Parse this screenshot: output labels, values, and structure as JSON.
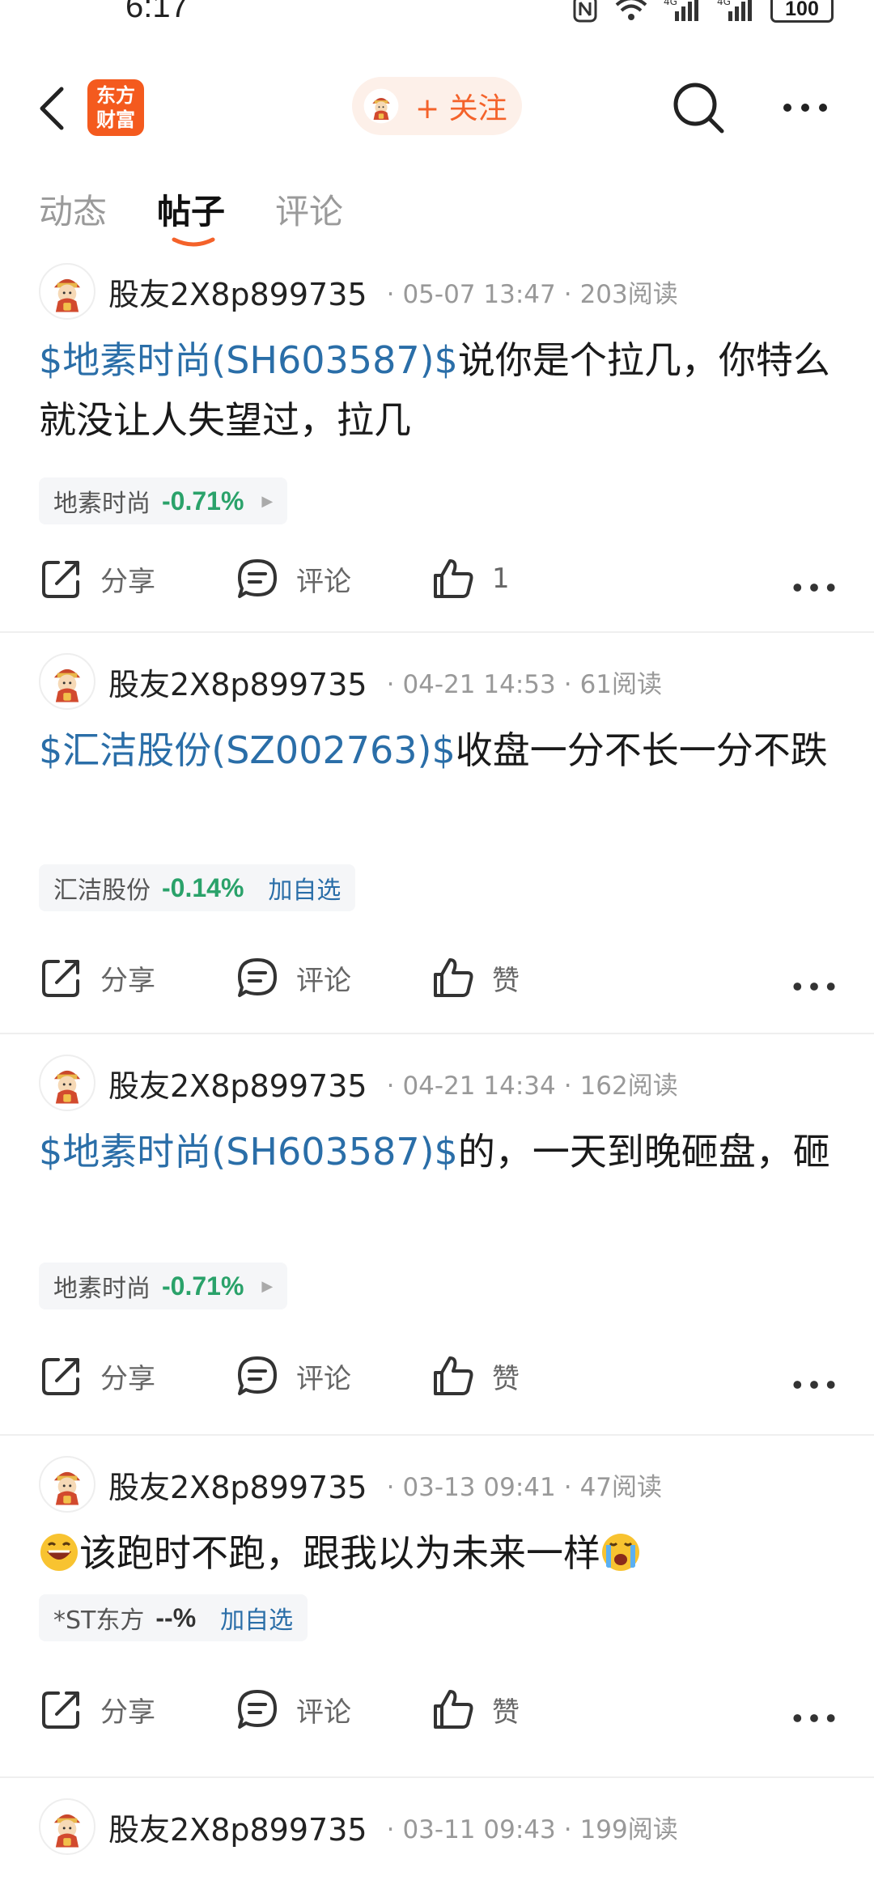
{
  "status_bar": {
    "time": "6:17",
    "battery": "100"
  },
  "header": {
    "logo_text_line1": "东方",
    "logo_text_line2": "财富",
    "follow_label": "+ 关注"
  },
  "tabs": [
    {
      "label": "动态",
      "active": false
    },
    {
      "label": "帖子",
      "active": true
    },
    {
      "label": "评论",
      "active": false
    }
  ],
  "actions": {
    "share": "分享",
    "comment": "评论"
  },
  "posts": [
    {
      "author": "股友2X8p899735",
      "date": "05-07 13:47",
      "reads": "203阅读",
      "stock_link": "$地素时尚(SH603587)$",
      "text": "说你是个拉几，你特么就没让人失望过，拉几",
      "tag_name": "地素时尚",
      "tag_change": "-0.71%",
      "like": "1"
    },
    {
      "author": "股友2X8p899735",
      "date": "04-21 14:53",
      "reads": "61阅读",
      "stock_link": "$汇洁股份(SZ002763)$",
      "text": "收盘一分不长一分不跌",
      "tag_name": "汇洁股份",
      "tag_change": "-0.14%",
      "tag_add": "加自选",
      "like": "赞"
    },
    {
      "author": "股友2X8p899735",
      "date": "04-21 14:34",
      "reads": "162阅读",
      "stock_link": "$地素时尚(SH603587)$",
      "text": "的，一天到晚砸盘，砸",
      "tag_name": "地素时尚",
      "tag_change": "-0.71%",
      "like": "赞"
    },
    {
      "author": "股友2X8p899735",
      "date": "03-13 09:41",
      "reads": "47阅读",
      "text": "该跑时不跑，跟我以为未来一样",
      "tag_name": "*ST东方",
      "tag_change": "--%",
      "tag_add": "加自选",
      "like": "赞"
    },
    {
      "author": "股友2X8p899735",
      "date": "03-11 09:43",
      "reads": "199阅读"
    }
  ],
  "colors": {
    "accent": "#f4622a",
    "link": "#2a6ea8",
    "down": "#2aa26a"
  }
}
